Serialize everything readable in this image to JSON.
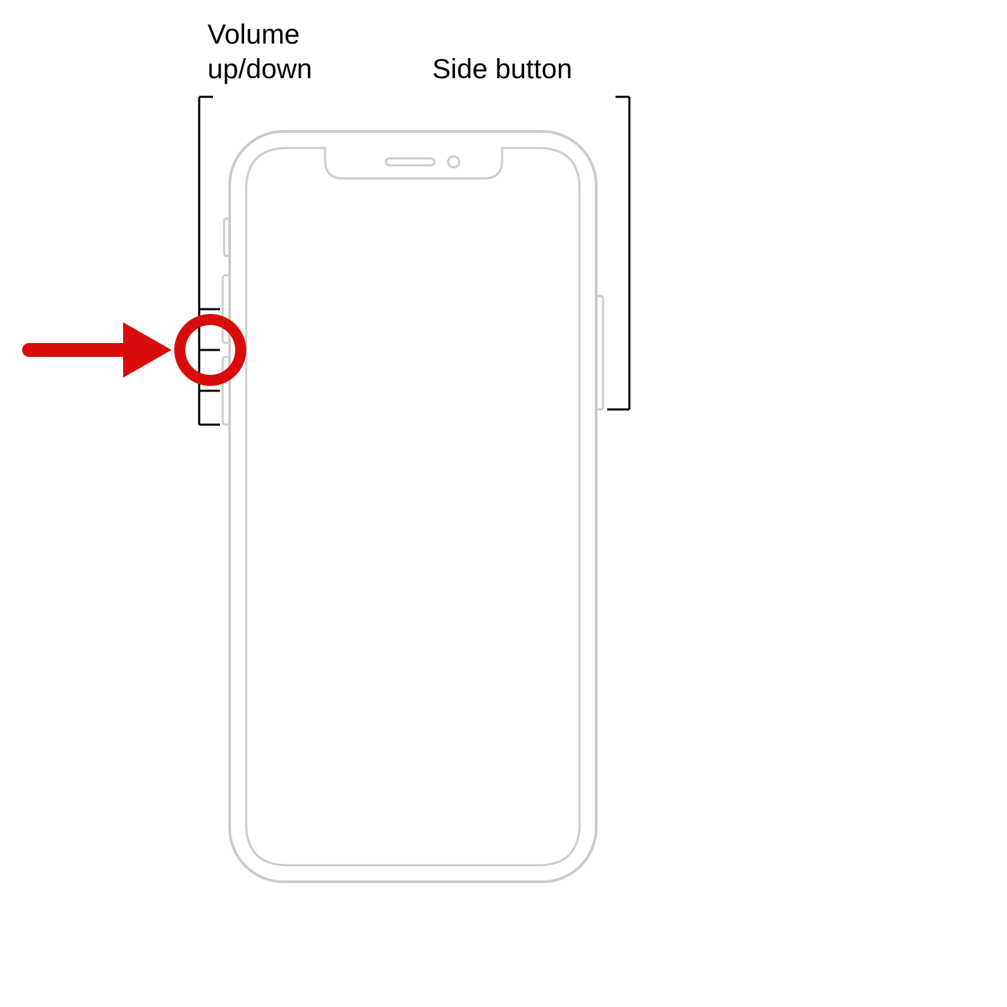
{
  "labels": {
    "volume": "Volume up/down",
    "side": "Side button"
  },
  "colors": {
    "outline": "#cccccc",
    "text": "#000000",
    "highlight": "#d90c0c"
  },
  "description": "iPhone button diagram highlighting the junction between volume up and volume down buttons with red circle and arrow"
}
